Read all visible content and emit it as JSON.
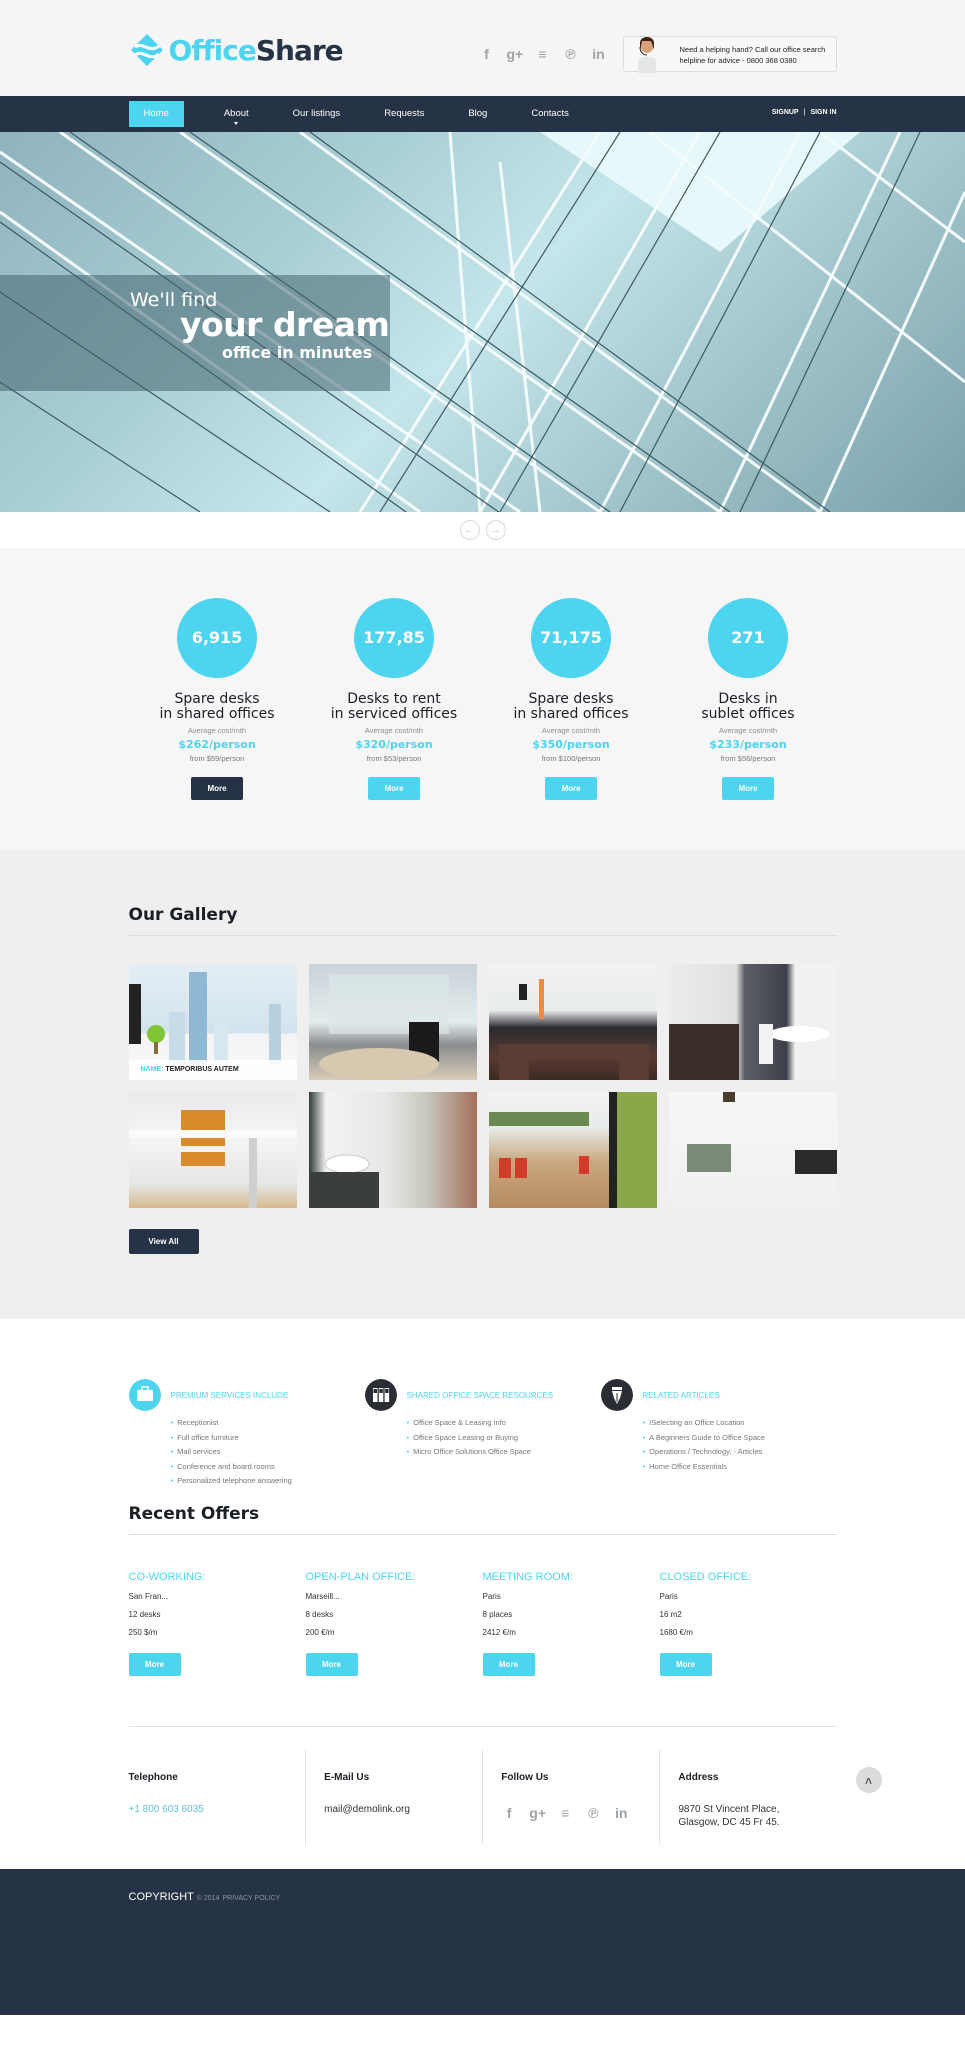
{
  "brand": {
    "name_part1": "Office",
    "name_part2": "Share",
    "accent": "#4dd4ef",
    "dark": "#263245"
  },
  "header": {
    "socials": [
      {
        "icon": "facebook-icon",
        "glyph": "f"
      },
      {
        "icon": "google-plus-icon",
        "glyph": "g+"
      },
      {
        "icon": "rss-icon",
        "glyph": "≡"
      },
      {
        "icon": "pinterest-icon",
        "glyph": "℗"
      },
      {
        "icon": "linkedin-icon",
        "glyph": "in"
      }
    ],
    "help_text": "Need a helping hand? Call our office search helpline for advice - 0800 368 0380"
  },
  "nav": {
    "items": [
      {
        "label": "Home",
        "active": true
      },
      {
        "label": "About",
        "dropdown": true
      },
      {
        "label": "Our listings"
      },
      {
        "label": "Requests"
      },
      {
        "label": "Blog"
      },
      {
        "label": "Contacts"
      }
    ],
    "signup": "SIGNUP",
    "separator": "|",
    "signin": "SIGN IN"
  },
  "hero": {
    "line1": "We'll find",
    "line2": "your dream",
    "line3": "office in minutes",
    "prev": "←",
    "next": "→"
  },
  "stats": [
    {
      "number": "6,915",
      "title1": "Spare desks",
      "title2": "in shared offices",
      "sub": "Average cost/mth",
      "price": "$262/person",
      "from": "from $59/person",
      "button": "More",
      "button_style": "dark"
    },
    {
      "number": "177,85",
      "title1": "Desks to rent",
      "title2": "in serviced offices",
      "sub": "Average cost/mth",
      "price": "$320/person",
      "from": "from $53/person",
      "button": "More",
      "button_style": "light"
    },
    {
      "number": "71,175",
      "title1": "Spare desks",
      "title2": "in shared offices",
      "sub": "Average cost/mth",
      "price": "$350/person",
      "from": "from $100/person",
      "button": "More",
      "button_style": "light"
    },
    {
      "number": "271",
      "title1": "Desks in",
      "title2": "sublet offices",
      "sub": "Average cost/mth",
      "price": "$233/person",
      "from": "from $56/person",
      "button": "More",
      "button_style": "light"
    }
  ],
  "gallery": {
    "title": "Our Gallery",
    "caption_key": "NAME:",
    "caption_value": "TEMPORIBUS AUTEM",
    "view_all": "View All"
  },
  "info": [
    {
      "icon": "briefcase-icon",
      "heading": "PREMIUM SERVICES INCLUDE",
      "items": [
        "Receptionist",
        "Full office furniture",
        "Mail services",
        "Conference and board rooms",
        "Personalized telephone answering"
      ]
    },
    {
      "icon": "binders-icon",
      "heading": "SHARED OFFICE SPACE RESOURCES",
      "items": [
        "Office Space & Leasing Info",
        "Office Space Leasing or Buying",
        "Micro Office Solutions Office Space"
      ]
    },
    {
      "icon": "pen-nib-icon",
      "heading": "RELATED ARTICLES",
      "items": [
        "ISelecting an Office Location",
        "A Beginners Guide to Office Space",
        "Operations / Technology, - Articles",
        "Home Office Essentials"
      ]
    }
  ],
  "offers": {
    "title": "Recent Offers",
    "items": [
      {
        "heading": "CO-WORKING:",
        "city": "San Fran...",
        "size": "12 desks",
        "price": "250 $/m",
        "button": "More"
      },
      {
        "heading": "OPEN-PLAN OFFICE:",
        "city": "Marseill...",
        "size": "8 desks",
        "price": "200 €/m",
        "button": "More"
      },
      {
        "heading": "MEETING ROOM:",
        "city": "Paris",
        "size": "8 places",
        "price": "2412 €/m",
        "button": "More"
      },
      {
        "heading": "CLOSED OFFICE:",
        "city": "Paris",
        "size": "16 m2",
        "price": "1680 €/m",
        "button": "More"
      }
    ]
  },
  "contacts": {
    "telephone_label": "Telephone",
    "telephone": "+1 800 603 6035",
    "email_label": "E-Mail Us",
    "email": "mail@demolink.org",
    "follow_label": "Follow Us",
    "address_label": "Address",
    "address_line1": "9870 St Vincent Place,",
    "address_line2": "Glasgow, DC 45 Fr 45.",
    "to_top": "˄"
  },
  "footer": {
    "copyright": "COPYRIGHT",
    "year": "© 2014",
    "privacy": "PRIVACY POLICY"
  }
}
